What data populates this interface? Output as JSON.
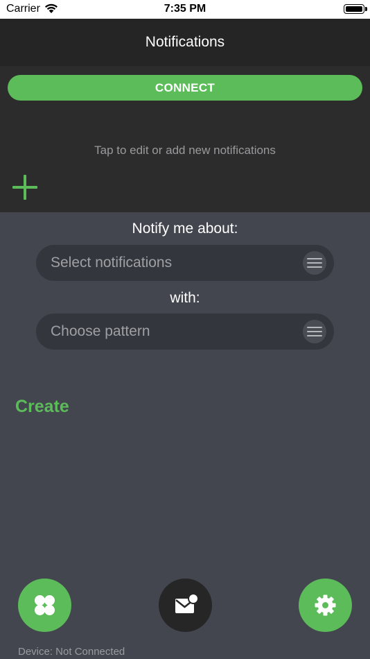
{
  "status_bar": {
    "carrier": "Carrier",
    "time": "7:35 PM"
  },
  "header": {
    "title": "Notifications"
  },
  "top_panel": {
    "connect_label": "CONNECT",
    "hint": "Tap to edit or add new notifications",
    "add_icon": "plus-icon"
  },
  "form": {
    "notify_label": "Notify me about:",
    "notifications_placeholder": "Select notifications",
    "with_label": "with:",
    "pattern_placeholder": "Choose pattern",
    "create_label": "Create"
  },
  "bottom_bar": {
    "left_icon": "grid-icon",
    "center_icon": "mail-badge-icon",
    "right_icon": "gear-icon"
  },
  "footer": {
    "device_status": "Device: Not Connected"
  },
  "colors": {
    "accent": "#5cbc5a",
    "header_bg": "#252526",
    "panel_bg": "#2c2c2d",
    "body_bg": "#43464f",
    "field_bg": "#34363d"
  }
}
